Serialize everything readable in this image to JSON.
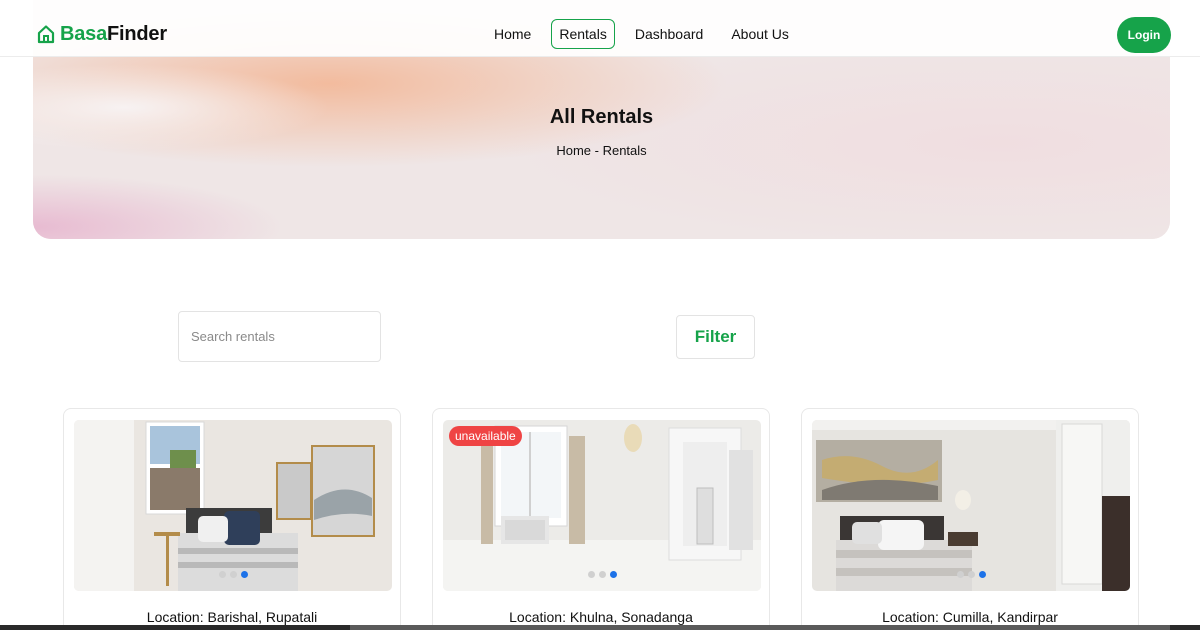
{
  "brand": {
    "part1": "Basa",
    "part2": "Finder",
    "icon": "home-outline-icon",
    "color": "#16a34a"
  },
  "nav": {
    "items": [
      {
        "label": "Home",
        "active": false
      },
      {
        "label": "Rentals",
        "active": true
      },
      {
        "label": "Dashboard",
        "active": false
      },
      {
        "label": "About Us",
        "active": false
      }
    ],
    "login_label": "Login"
  },
  "hero": {
    "title": "All Rentals",
    "breadcrumb": "Home - Rentals"
  },
  "search": {
    "placeholder": "Search rentals",
    "value": ""
  },
  "filter": {
    "label": "Filter"
  },
  "listings": [
    {
      "location": "Location: Barishal, Rupatali",
      "badge": "",
      "slide": 3,
      "slides": 3
    },
    {
      "location": "Location: Khulna, Sonadanga",
      "badge": "unavailable",
      "slide": 3,
      "slides": 3
    },
    {
      "location": "Location: Cumilla, Kandirpar",
      "badge": "",
      "slide": 3,
      "slides": 3
    }
  ],
  "colors": {
    "accent": "#16a34a",
    "badge": "#ef4444",
    "dot_active": "#1d72e8"
  }
}
